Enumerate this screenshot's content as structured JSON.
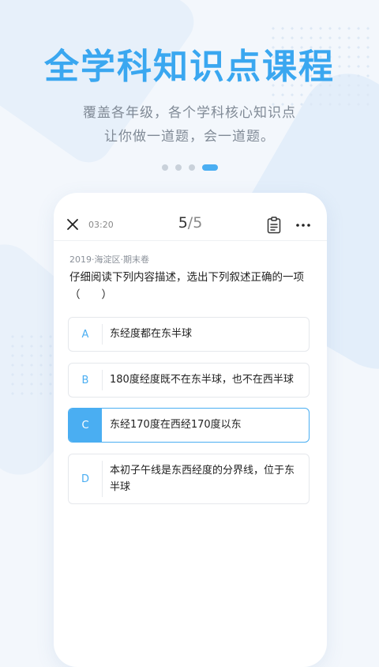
{
  "hero": {
    "title": "全学科知识点课程",
    "subtitle_line1": "覆盖各年级，各个学科核心知识点",
    "subtitle_line2": "让你做一道题，会一道题。"
  },
  "carousel": {
    "page_count": 4,
    "active_index": 3
  },
  "quiz": {
    "timer": "03:20",
    "current": "5",
    "separator": "/",
    "total": "5",
    "source": "2019·海淀区·期末卷",
    "question_line1": "仔细阅读下列内容描述，选出下列叙述正确的一项",
    "question_line2": "（　　）",
    "options": [
      {
        "letter": "A",
        "text": "东经度都在东半球",
        "selected": false
      },
      {
        "letter": "B",
        "text": "180度经度既不在东半球，也不在西半球",
        "selected": false
      },
      {
        "letter": "C",
        "text": "东经170度在西经170度以东",
        "selected": true
      },
      {
        "letter": "D",
        "text": "本初子午线是东西经度的分界线，位于东半球",
        "selected": false
      }
    ]
  },
  "colors": {
    "accent": "#4aaef2",
    "headline": "#3aa7f0"
  },
  "icons": [
    "close-icon",
    "answer-sheet-icon",
    "more-icon"
  ]
}
